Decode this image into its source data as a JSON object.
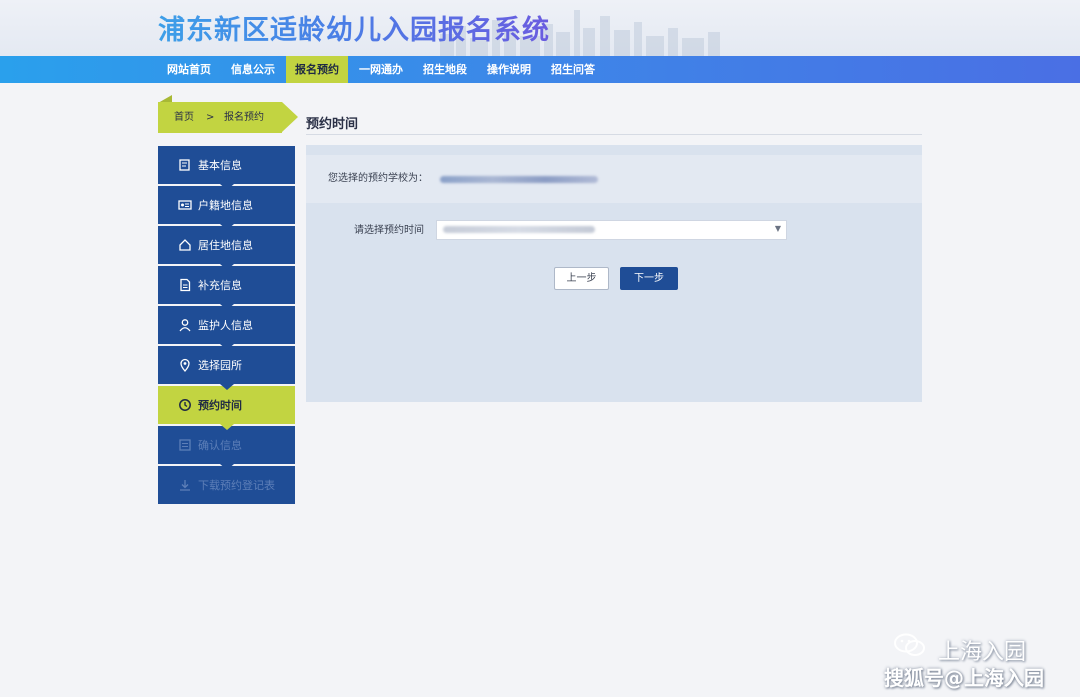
{
  "header": {
    "title": "浦东新区适龄幼儿入园报名系统"
  },
  "nav": {
    "items": [
      {
        "label": "网站首页"
      },
      {
        "label": "信息公示"
      },
      {
        "label": "报名预约"
      },
      {
        "label": "一网通办"
      },
      {
        "label": "招生地段"
      },
      {
        "label": "操作说明"
      },
      {
        "label": "招生问答"
      }
    ],
    "active_index": 2
  },
  "breadcrumb": {
    "home": "首页",
    "separator": ">",
    "current": "报名预约"
  },
  "section": {
    "title": "预约时间"
  },
  "sidebar": {
    "items": [
      {
        "label": "基本信息",
        "icon": "form-icon"
      },
      {
        "label": "户籍地信息",
        "icon": "id-card-icon"
      },
      {
        "label": "居住地信息",
        "icon": "home-icon"
      },
      {
        "label": "补充信息",
        "icon": "document-icon"
      },
      {
        "label": "监护人信息",
        "icon": "person-icon"
      },
      {
        "label": "选择园所",
        "icon": "location-pin-icon"
      },
      {
        "label": "预约时间",
        "icon": "clock-icon"
      },
      {
        "label": "确认信息",
        "icon": "checklist-icon"
      },
      {
        "label": "下载预约登记表",
        "icon": "download-icon"
      }
    ],
    "active_index": 6
  },
  "form": {
    "school_label": "您选择的预约学校为：",
    "time_label": "请选择预约时间",
    "prev_button": "上一步",
    "next_button": "下一步"
  },
  "watermark": {
    "account": "上海入园",
    "source": "搜狐号@上海入园"
  },
  "colors": {
    "nav_blue": "#3d86e8",
    "active_green": "#c2d441",
    "sidebar_navy": "#1f4d96"
  }
}
